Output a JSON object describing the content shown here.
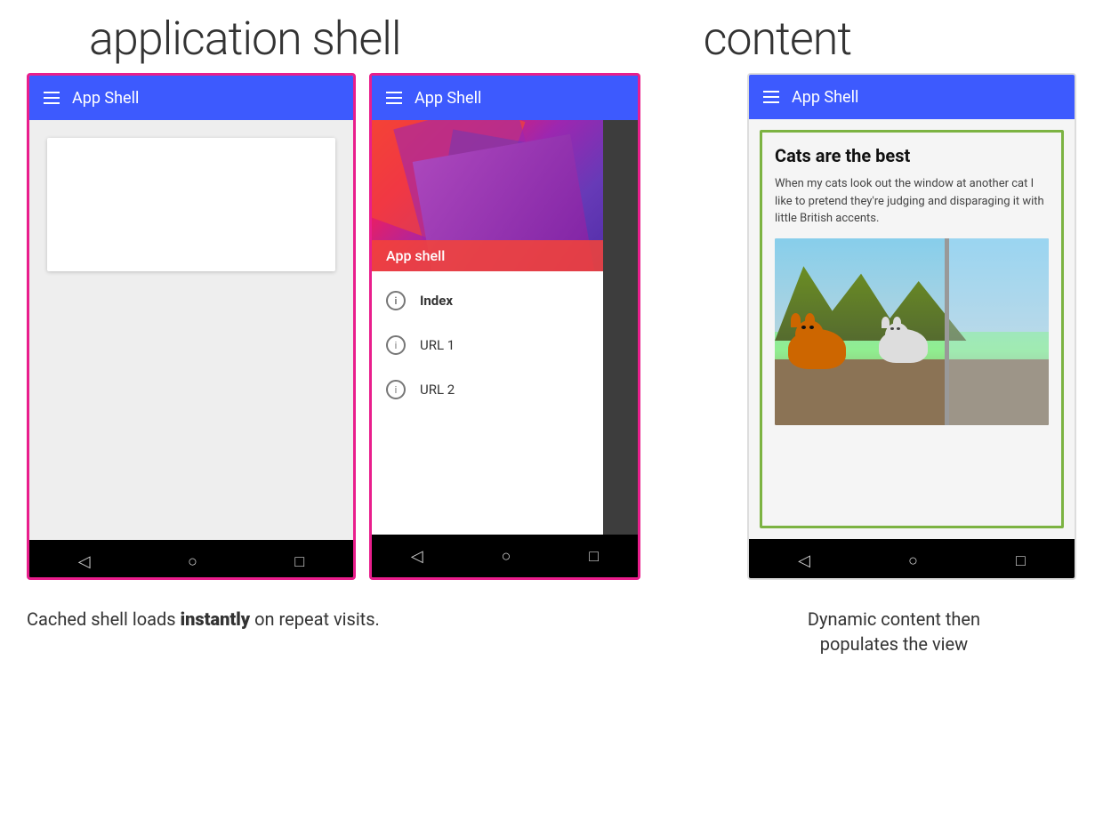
{
  "labels": {
    "app_shell": "application shell",
    "content": "content"
  },
  "phone1": {
    "app_bar_title": "App Shell",
    "border_color": "#e91e8c"
  },
  "phone2": {
    "app_bar_title": "App Shell",
    "drawer_hero_label": "App shell",
    "nav_items": [
      {
        "label": "Index",
        "active": true
      },
      {
        "label": "URL 1",
        "active": false
      },
      {
        "label": "URL 2",
        "active": false
      }
    ],
    "border_color": "#e91e8c"
  },
  "phone3": {
    "app_bar_title": "App Shell",
    "content_title": "Cats are the best",
    "content_text": "When my cats look out the window at another cat I like to pretend they're judging and disparaging it with little British accents.",
    "border_color": "#7cb342"
  },
  "captions": {
    "left": "Cached shell loads ",
    "left_bold": "instantly",
    "left_end": " on repeat visits.",
    "right_line1": "Dynamic content then",
    "right_line2": "populates the view"
  },
  "nav": {
    "back": "◁",
    "home": "○",
    "recent": "□"
  }
}
